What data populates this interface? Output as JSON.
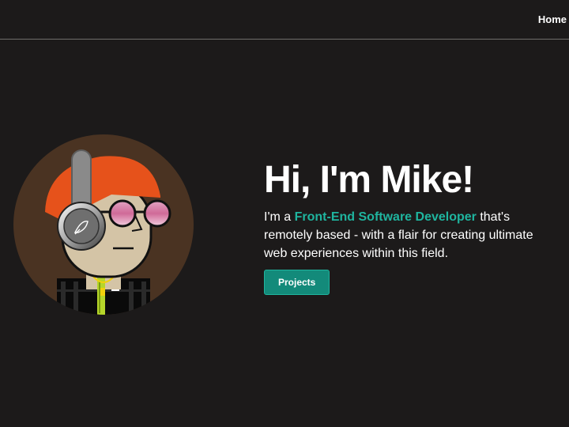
{
  "nav": {
    "home_label": "Home"
  },
  "hero": {
    "headline": "Hi, I'm Mike!",
    "intro_prefix": "I'm a",
    "intro_highlight": "Front-End Software Developer",
    "intro_suffix": "that's remotely based - with a flair for creating ultimate web experiences within this field.",
    "projects_button": "Projects"
  },
  "avatar": {
    "icon": "avatar-illustration"
  },
  "colors": {
    "background": "#1c1a1a",
    "accent": "#1fb59f",
    "button": "#138a7a",
    "divider": "#6f6d6b",
    "hair": "#e6521b",
    "avatar_circle": "#4a3322",
    "lens": "#d87ea8"
  }
}
